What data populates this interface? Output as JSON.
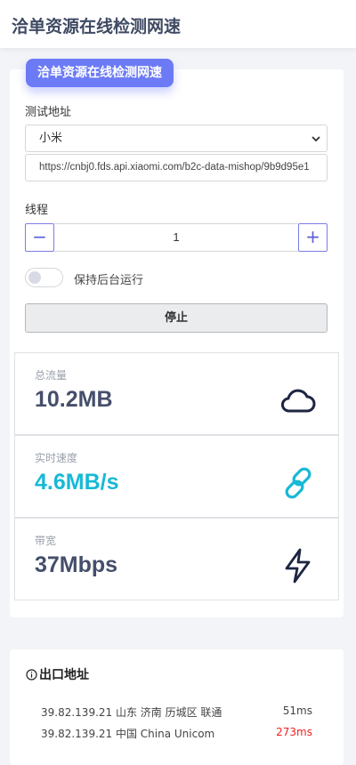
{
  "header": {
    "title": "洽单资源在线检测网速"
  },
  "main": {
    "badge": "洽单资源在线检测网速",
    "test_address_label": "测试地址",
    "source_select": {
      "selected": "小米"
    },
    "url_input": {
      "value": "https://cnbj0.fds.api.xiaomi.com/b2c-data-mishop/9b9d95e1"
    },
    "threads_label": "线程",
    "threads": {
      "minus": "−",
      "value": "1",
      "plus": "+"
    },
    "background_toggle": {
      "label": "保持后台运行",
      "on": false
    },
    "stop_button": "停止"
  },
  "stats": [
    {
      "label": "总流量",
      "value": "10.2MB",
      "color": "#454f6b",
      "icon": "cloud-icon"
    },
    {
      "label": "实时速度",
      "value": "4.6MB/s",
      "color": "#17b9d6",
      "icon": "link-icon"
    },
    {
      "label": "带宽",
      "value": "37Mbps",
      "color": "#454f6b",
      "icon": "bolt-icon"
    }
  ],
  "exit": {
    "title": "出口地址",
    "rows": [
      {
        "ip": "39.82.139.21 山东 济南 历城区 联通",
        "ms": "51ms",
        "ms_color": "#444444"
      },
      {
        "ip": "39.82.139.21 中国 China Unicom",
        "ms": "273ms",
        "ms_color": "#ee2222"
      }
    ]
  }
}
